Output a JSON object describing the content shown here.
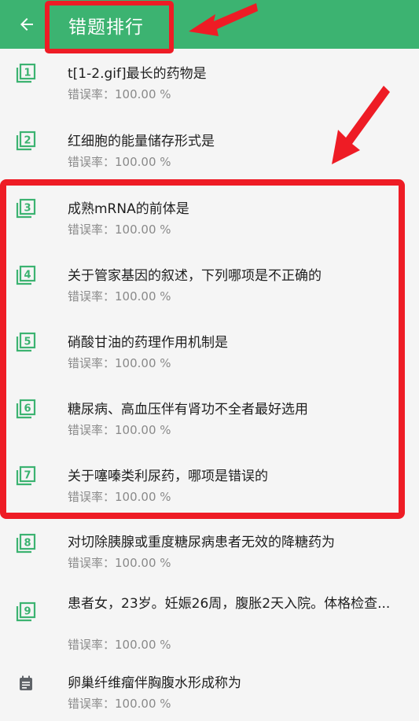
{
  "header": {
    "title": "错题排行",
    "back_icon": "arrow-left-icon",
    "bg_color": "#3cb371"
  },
  "annotations": {
    "color": "#ee1c25"
  },
  "items": [
    {
      "num": "1",
      "question": "t[1-2.gif]最长的药物是",
      "rate_label": "错误率：",
      "rate": "100.00 %"
    },
    {
      "num": "2",
      "question": "红细胞的能量储存形式是",
      "rate_label": "错误率：",
      "rate": "100.00 %"
    },
    {
      "num": "3",
      "question": "成熟mRNA的前体是",
      "rate_label": "错误率：",
      "rate": "100.00 %"
    },
    {
      "num": "4",
      "question": "关于管家基因的叙述，下列哪项是不正确的",
      "rate_label": "错误率：",
      "rate": "100.00 %"
    },
    {
      "num": "5",
      "question": "硝酸甘油的药理作用机制是",
      "rate_label": "错误率：",
      "rate": "100.00 %"
    },
    {
      "num": "6",
      "question": "糖尿病、高血压伴有肾功不全者最好选用",
      "rate_label": "错误率：",
      "rate": "100.00 %"
    },
    {
      "num": "7",
      "question": "关于噻嗪类利尿药，哪项是错误的",
      "rate_label": "错误率：",
      "rate": "100.00 %"
    },
    {
      "num": "8",
      "question": "对切除胰腺或重度糖尿病患者无效的降糖药为",
      "rate_label": "错误率：",
      "rate": "100.00 %"
    },
    {
      "num": "9",
      "question": "患者女，23岁。妊娠26周，腹胀2天入院。体格检查...",
      "rate_label": "错误率：",
      "rate": "100.00 %"
    },
    {
      "num": "",
      "question": "卵巢纤维瘤伴胸腹水形成称为",
      "rate_label": "错误率：",
      "rate": "100.00 %"
    }
  ]
}
